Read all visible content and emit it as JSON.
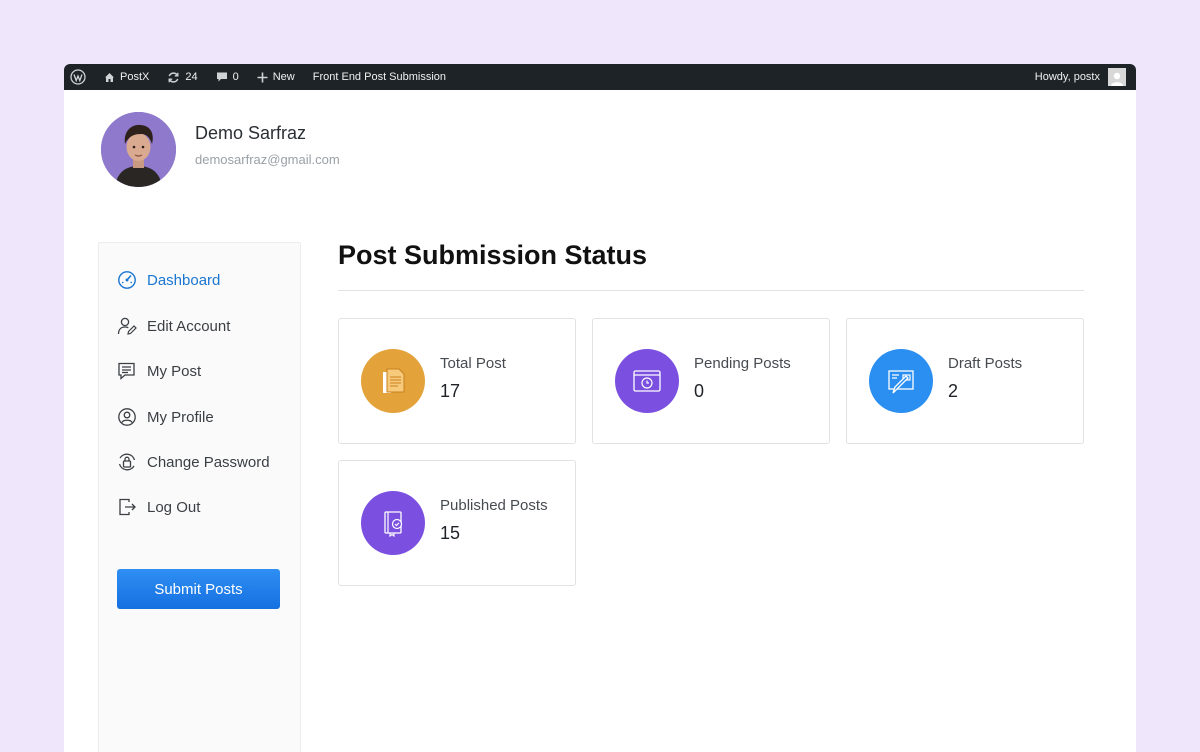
{
  "colors": {
    "background": "#efe6fc",
    "admin_bar": "#1d2327",
    "accent": "#1976d2",
    "total_icon": "#e3a33a",
    "pending_icon": "#7b4fe0",
    "draft_icon": "#2a8ff0",
    "published_icon": "#7b4fe0"
  },
  "admin_bar": {
    "site_name": "PostX",
    "updates_count": "24",
    "comments_count": "0",
    "new_label": "New",
    "page_label": "Front End Post Submission",
    "greeting": "Howdy, postx"
  },
  "profile": {
    "name": "Demo Sarfraz",
    "email": "demosarfraz@gmail.com"
  },
  "sidebar": {
    "items": [
      {
        "label": "Dashboard",
        "icon": "dashboard-icon",
        "active": true
      },
      {
        "label": "Edit Account",
        "icon": "user-edit-icon"
      },
      {
        "label": "My Post",
        "icon": "post-icon"
      },
      {
        "label": "My Profile",
        "icon": "profile-icon"
      },
      {
        "label": "Change Password",
        "icon": "lock-icon"
      },
      {
        "label": "Log Out",
        "icon": "logout-icon"
      }
    ],
    "submit_label": "Submit Posts"
  },
  "main": {
    "title": "Post Submission Status",
    "cards": [
      {
        "label": "Total Post",
        "value": "17",
        "icon": "document-icon"
      },
      {
        "label": "Pending Posts",
        "value": "0",
        "icon": "browser-clock-icon"
      },
      {
        "label": "Draft Posts",
        "value": "2",
        "icon": "draft-pen-icon"
      },
      {
        "label": "Published Posts",
        "value": "15",
        "icon": "book-check-icon"
      }
    ]
  }
}
